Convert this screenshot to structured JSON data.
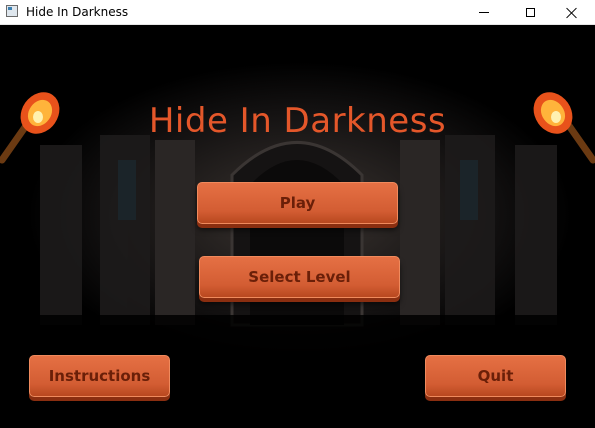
{
  "window": {
    "title": "Hide In Darkness"
  },
  "game": {
    "title": "Hide In Darkness",
    "title_color": "#e4572a",
    "button_color": "#d8633a",
    "buttons": {
      "play": "Play",
      "select_level": "Select Level",
      "instructions": "Instructions",
      "quit": "Quit"
    },
    "decorations": [
      "torch-icon",
      "torch-icon"
    ]
  }
}
